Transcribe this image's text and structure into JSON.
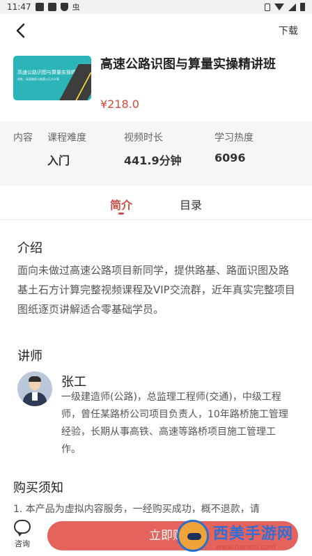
{
  "status_bar": {
    "time": "11:47",
    "glyph": "虫"
  },
  "nav": {
    "download_label": "下载"
  },
  "course": {
    "title": "高速公路识图与算量实操精讲班",
    "price": "¥218.0",
    "cover_title": "高速公路识图与算量实操精讲班",
    "cover_subtitle": "陪练、高速路图与路基公石方计算"
  },
  "info": {
    "tag": "内容",
    "difficulty_label": "课程难度",
    "difficulty_value": "入门",
    "duration_label": "视频时长",
    "duration_value": "441.9分钟",
    "popularity_label": "学习热度",
    "popularity_value": "6096"
  },
  "tabs": [
    {
      "label": "简介",
      "active": true
    },
    {
      "label": "目录",
      "active": false
    }
  ],
  "intro": {
    "heading": "介绍",
    "body": "面向未做过高速公路项目新同学，提供路基、路面识图及路基土石方计算完整视频课程及VIP交流群，近年真实完整项目图纸逐页讲解适合零基础学员。"
  },
  "teacher": {
    "heading": "讲师",
    "name": "张工",
    "bio": "一级建造师(公路)，总监理工程师(交通)，中级工程师，曾任某路桥公司项目负责人，10年路桥施工管理经验，长期从事高铁、高速等路桥项目施工管理工作。"
  },
  "notice": {
    "heading": "购买须知",
    "line1": "1. 本产品为虚拟内容服务，一经购买成功，概不退款，请"
  },
  "bottom": {
    "consult_label": "咨询",
    "buy_label": "立即购买"
  },
  "watermark": {
    "title": "西美手游网",
    "url": "www.hanxm.com"
  },
  "colors": {
    "accent": "#c94f47",
    "price": "#d9493e",
    "buy_button": "#e4635c",
    "cover": "#2bb5b8"
  }
}
